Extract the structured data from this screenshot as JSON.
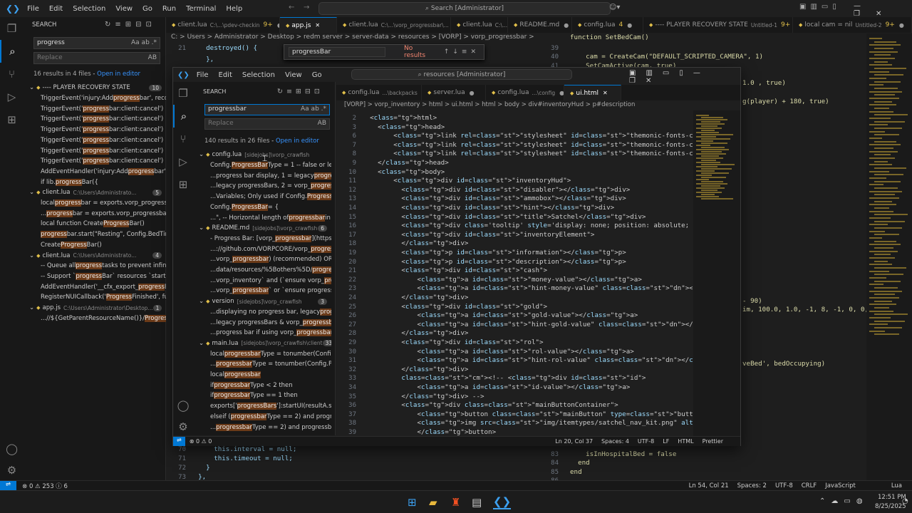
{
  "outer": {
    "menu": [
      "File",
      "Edit",
      "Selection",
      "View",
      "Go",
      "Run",
      "Terminal",
      "Help"
    ],
    "command_search": "Search [Administrator]",
    "sidebar": {
      "title": "SEARCH",
      "search_value": "progress",
      "replace_placeholder": "Replace",
      "results_summary": "16 results in 4 files",
      "open_in_editor": "Open in editor",
      "rows": [
        {
          "type": "file",
          "name": "---- PLAYER RECOVERY STATE",
          "path": "",
          "badge": "10"
        },
        {
          "type": "match",
          "pre": "TriggerEvent('injury:Add",
          "hit": "progress",
          "post": "bar', recov..."
        },
        {
          "type": "match",
          "pre": "TriggerEvent('",
          "hit": "progress",
          "post": "bar:client:cancel')"
        },
        {
          "type": "match",
          "pre": "TriggerEvent('",
          "hit": "progress",
          "post": "bar:client:cancel')"
        },
        {
          "type": "match",
          "pre": "TriggerEvent('",
          "hit": "progress",
          "post": "bar:client:cancel')"
        },
        {
          "type": "match",
          "pre": "TriggerEvent('",
          "hit": "progress",
          "post": "bar:client:cancel')"
        },
        {
          "type": "match",
          "pre": "TriggerEvent('",
          "hit": "progress",
          "post": "bar:client:cancel')"
        },
        {
          "type": "match",
          "pre": "TriggerEvent('",
          "hit": "progress",
          "post": "bar:client:cancel')"
        },
        {
          "type": "match",
          "pre": "AddEventHandler('injury:Add",
          "hit": "progress",
          "post": "bar', f..."
        },
        {
          "type": "match",
          "pre": "if lib.",
          "hit": "progress",
          "post": "Bar({"
        },
        {
          "type": "file",
          "name": "client.lua",
          "path": "C:\\Users\\Administrato...",
          "badge": "5"
        },
        {
          "type": "match",
          "pre": "local ",
          "hit": "progress",
          "post": "bar = exports.vorp_progressb..."
        },
        {
          "type": "match",
          "pre": "...",
          "hit": "progress",
          "post": "bar = exports.vorp_progressbari..."
        },
        {
          "type": "match",
          "pre": "local function Create",
          "hit": "Progress",
          "post": "Bar()"
        },
        {
          "type": "match",
          "pre": "",
          "hit": "progress",
          "post": "bar.start(\"Resting\", Config.BedTime..."
        },
        {
          "type": "match",
          "pre": "Create",
          "hit": "Progress",
          "post": "Bar()"
        },
        {
          "type": "file",
          "name": "client.lua",
          "path": "C:\\Users\\Administrato...",
          "badge": "4"
        },
        {
          "type": "match",
          "pre": "-- Queue all ",
          "hit": "progress",
          "post": " tasks to prevent infini..."
        },
        {
          "type": "match",
          "pre": "-- Support `",
          "hit": "progress",
          "post": "Bar` resources `startUI` ..."
        },
        {
          "type": "match",
          "pre": "AddEventHandler('__cfx_export_",
          "hit": "progress",
          "post": "Bar..."
        },
        {
          "type": "match",
          "pre": "RegisterNUICallback('",
          "hit": "Progress",
          "post": "Finished', fun..."
        },
        {
          "type": "file",
          "name": "app.js",
          "path": "C:\\Users\\Administrator\\Desktop...",
          "badge": "1"
        },
        {
          "type": "match",
          "pre": "...//${GetParentResourceName()}/",
          "hit": "Progress",
          "post": "F..."
        }
      ]
    },
    "tabs": [
      {
        "label": "client.lua",
        "path": "C:\\...\\pdev-checkin",
        "badge": "9+"
      },
      {
        "label": "app.js",
        "path": "",
        "badge": "",
        "active": true
      },
      {
        "label": "client.lua",
        "path": "C:\\...\\vorp_progressbar\\...",
        "badge": "9+"
      },
      {
        "label": "client.lua",
        "path": "C:\\...",
        "badge": ""
      },
      {
        "label": "README.md",
        "path": "",
        "badge": ""
      },
      {
        "label": "config.lua",
        "path": "",
        "badge": "4"
      },
      {
        "label": "---- PLAYER RECOVERY STATE",
        "path": "Untitled-1",
        "badge": "9+"
      },
      {
        "label": "local cam = nil",
        "path": "Untitled-2",
        "badge": "9+"
      }
    ],
    "breadcrumb": "C: > Users > Administrator > Desktop > redm server > server-data > resources > [VORP] > vorp_progressbar > ui > html > JS app.js > ...",
    "find_widget": {
      "value": "progressBar",
      "result": "No results"
    },
    "left_code": [
      {
        "n": "21",
        "t": "    destroyed() {"
      },
      {
        "n": "",
        "t": "    },"
      },
      {
        "n": "70",
        "t": "      this.interval = null;"
      },
      {
        "n": "71",
        "t": "      this.timeout = null;"
      },
      {
        "n": "72",
        "t": "    }"
      },
      {
        "n": "73",
        "t": "  },"
      }
    ],
    "right_code": [
      {
        "n": "",
        "t": "function SetBedCam()"
      },
      {
        "n": "39",
        "t": ""
      },
      {
        "n": "40",
        "t": "    cam = CreateCam(\"DEFAULT_SCRIPTED_CAMERA\", 1)"
      },
      {
        "n": "41",
        "t": "    SetCamActive(cam, true)"
      },
      {
        "n": "",
        "t": "1.0 , true)"
      },
      {
        "n": "",
        "t": "g(player) + 180, true)"
      },
      {
        "n": "",
        "t": "- 90)"
      },
      {
        "n": "",
        "t": "im, 100.0, 1.0, -1, 8, -1, 0, 0, 0"
      },
      {
        "n": "",
        "t": "veBed', bedOccupying)"
      },
      {
        "n": "83",
        "t": "    isInHospitalBed = false"
      },
      {
        "n": "84",
        "t": "  end"
      },
      {
        "n": "85",
        "t": "end"
      },
      {
        "n": "86",
        "t": ""
      }
    ],
    "status": {
      "left": "⊗ 0 ⚠ 253 ⓘ 6",
      "ln": "Ln 54, Col 21",
      "spaces": "Spaces: 2",
      "enc": "UTF-8",
      "eol": "CRLF",
      "lang": "JavaScript",
      "lang2": "Lua"
    }
  },
  "inner": {
    "menu": [
      "File",
      "Edit",
      "Selection",
      "View",
      "Go"
    ],
    "command_search": "resources [Administrator]",
    "sidebar": {
      "title": "SEARCH",
      "search_value": "progressbar",
      "replace_placeholder": "Replace",
      "results_summary": "140 results in 26 files",
      "open_in_editor": "Open in editor",
      "rows": [
        {
          "type": "file",
          "name": "config.lua",
          "path": "[sidejobs]\\vorp_crawfish",
          "badge": ""
        },
        {
          "type": "match",
          "pre": "Config.",
          "hit": "ProgressBar",
          "post": "Type = 1 -- false or less t..."
        },
        {
          "type": "match",
          "pre": "...progress bar display, 1 = legacy ",
          "hit": "progress",
          "post": "..."
        },
        {
          "type": "match",
          "pre": "...legacy progressBars, 2 = vorp_",
          "hit": "progressb",
          "post": "..."
        },
        {
          "type": "match",
          "pre": "...Variables;  Only used if Config.",
          "hit": "ProgressBar",
          "post": "..."
        },
        {
          "type": "match",
          "pre": "Config.",
          "hit": "ProgressBar",
          "post": " = {"
        },
        {
          "type": "match",
          "pre": "...\", -- Horizontal length of ",
          "hit": "progressbar",
          "post": " in C..."
        },
        {
          "type": "file",
          "name": "README.md",
          "path": "[sidejobs]\\vorp_crawfish",
          "badge": "6"
        },
        {
          "type": "match",
          "pre": "- Progress Bar: [vorp_",
          "hit": "progressbar",
          "post": "](https://g..."
        },
        {
          "type": "match",
          "pre": "...://github.com/VORPCORE/vorp_",
          "hit": "progressb",
          "post": "..."
        },
        {
          "type": "match",
          "pre": "...vorp_",
          "hit": "progressbar",
          "post": ") (recommended) OR [pr..."
        },
        {
          "type": "match",
          "pre": "...data/resources/%5Bothers%5D/",
          "hit": "progressB",
          "post": "..."
        },
        {
          "type": "match",
          "pre": "...vorp_inventory` and (`ensure vorp_",
          "hit": "progressb",
          "post": ""
        },
        {
          "type": "match",
          "pre": "...vorp_",
          "hit": "progressbar",
          "post": "` or `ensure progressBar..."
        },
        {
          "type": "file",
          "name": "version",
          "path": "[sidejobs]\\vorp_crawfish",
          "badge": "3"
        },
        {
          "type": "match",
          "pre": "...displaying no progress bar, legacy ",
          "hit": "progress",
          "post": "..."
        },
        {
          "type": "match",
          "pre": "...legacy progressBars & vorp_",
          "hit": "progressbar",
          "post": ""
        },
        {
          "type": "match",
          "pre": "...progress bar if using vorp_",
          "hit": "progressbar",
          "post": ""
        },
        {
          "type": "file",
          "name": "main.lua",
          "path": "[sidejobs]\\vorp_crawfish\\client",
          "badge": "33"
        },
        {
          "type": "match",
          "pre": "local ",
          "hit": "progressbar",
          "post": "Type = tonumber(Config.P..."
        },
        {
          "type": "match",
          "pre": "...",
          "hit": "progressbar",
          "post": "Type = tonumber(Config.Prog..."
        },
        {
          "type": "match",
          "pre": "local ",
          "hit": "progressbar",
          "post": ""
        },
        {
          "type": "match",
          "pre": "if ",
          "hit": "progressbar",
          "post": "Type < 2 then"
        },
        {
          "type": "match",
          "pre": "if ",
          "hit": "progressbar",
          "post": "Type  == 1 then"
        },
        {
          "type": "match",
          "pre": "exports['",
          "hit": "progressBars",
          "post": "']:startUI(resultA.searc..."
        },
        {
          "type": "match",
          "pre": "elseif (",
          "hit": "progressbar",
          "post": "Type == 2) and progress..."
        },
        {
          "type": "match",
          "pre": "...",
          "hit": "progressbar",
          "post": "Type == 2) and progressba..."
        }
      ]
    },
    "tabs": [
      {
        "label": "config.lua",
        "path": "...\\backpacks"
      },
      {
        "label": "server.lua",
        "path": ""
      },
      {
        "label": "config.lua",
        "path": "...\\config"
      },
      {
        "label": "ui.html",
        "path": "",
        "active": true
      }
    ],
    "breadcrumb": "[VORP] > vorp_inventory > html > ui.html > html > body > div#inventoryHud > p#description",
    "code": [
      {
        "n": "2",
        "t": "  <html>"
      },
      {
        "n": "3",
        "t": "    <head>"
      },
      {
        "n": "6",
        "t": "        <link rel=\"stylesheet\" id=\"themonic-fonts-css\" href=\"css/contextMenu.min.css\" ty"
      },
      {
        "n": "7",
        "t": "        <link rel=\"stylesheet\" id=\"themonic-fonts-css\" href=\"css/jquery.dialog.min.css\""
      },
      {
        "n": "8",
        "t": "        <link rel=\"stylesheet\" id=\"themonic-fonts-css\" href=\"css/ui.min.css\" type=\"text/"
      },
      {
        "n": "9",
        "t": "    </head>"
      },
      {
        "n": "10",
        "t": "    <body>"
      },
      {
        "n": "11",
        "t": "        <div id=\"inventoryHud\">"
      },
      {
        "n": "12",
        "t": "          <div id=\"disabler\"></div>"
      },
      {
        "n": "13",
        "t": "          <div id=\"ammobox\"></div>"
      },
      {
        "n": "14",
        "t": "          <div id=\"hint\"></div>"
      },
      {
        "n": "15",
        "t": "          <div id=\"title\">Satchel</div>"
      },
      {
        "n": "16",
        "t": "          <div class='tooltip' style='display: none; position: absolute; padding: 10px"
      },
      {
        "n": "17",
        "t": "          <div id=\"inventoryElement\">"
      },
      {
        "n": "18",
        "t": "          </div>"
      },
      {
        "n": "19",
        "t": "          <p id=\"information\"></p>"
      },
      {
        "n": "20",
        "t": "          <p id=\"description\"></p>"
      },
      {
        "n": "21",
        "t": "          <div id=\"cash\">"
      },
      {
        "n": "22",
        "t": "              <a id=\"money-value\"></a>"
      },
      {
        "n": "23",
        "t": "              <a id=\"hint-money-value\" class=\"dn\"></a>"
      },
      {
        "n": "24",
        "t": "          </div>"
      },
      {
        "n": "25",
        "t": "          <div id=\"gold\">"
      },
      {
        "n": "26",
        "t": "              <a id=\"gold-value\"></a>"
      },
      {
        "n": "27",
        "t": "              <a id=\"hint-gold-value\" class=\"dn\"></a>"
      },
      {
        "n": "28",
        "t": "          </div>"
      },
      {
        "n": "29",
        "t": "          <div id=\"rol\">"
      },
      {
        "n": "30",
        "t": "              <a id=\"rol-value\"></a>"
      },
      {
        "n": "31",
        "t": "              <a id=\"hint-rol-value\" class=\"dn\"></a>"
      },
      {
        "n": "32",
        "t": "          </div>"
      },
      {
        "n": "33",
        "t": "          <!-- <div id=\"id\">"
      },
      {
        "n": "34",
        "t": "              <a id=\"id-value\"></a>"
      },
      {
        "n": "35",
        "t": "          </div> -->"
      },
      {
        "n": "36",
        "t": "          <div class=\"mainButtonContainer\">"
      },
      {
        "n": "37",
        "t": "              <button class=\"mainButton\" type=\"button\" data-target=\"mainButton1\" oncli"
      },
      {
        "n": "38",
        "t": "              <img src=\"img/itemtypes/satchel_nav_kit.png\" alt=\"Main Button Image\">"
      },
      {
        "n": "39",
        "t": "              </button>"
      }
    ],
    "status": {
      "left": "⊗ 0 ⚠ 0",
      "ln": "Ln 20, Col 37",
      "spaces": "Spaces: 4",
      "enc": "UTF-8",
      "eol": "LF",
      "lang": "HTML",
      "fmt": "Prettier"
    }
  },
  "taskbar": {
    "time": "12:51 PM",
    "date": "8/25/2025"
  }
}
